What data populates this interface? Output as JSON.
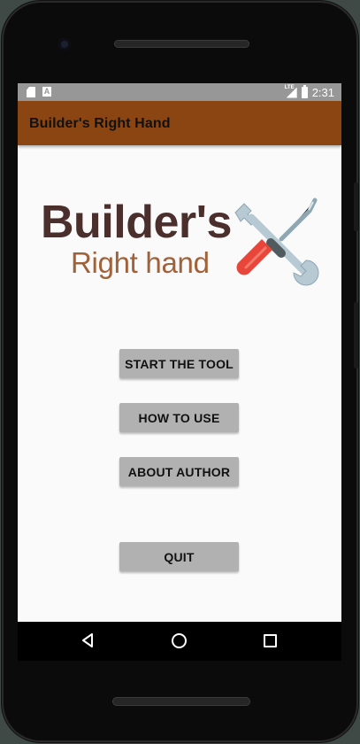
{
  "status_bar": {
    "time": "2:31",
    "signal_label": "LTE"
  },
  "app_bar": {
    "title": "Builder's Right Hand"
  },
  "logo": {
    "title": "Builder's",
    "subtitle": "Right hand",
    "title_color": "#4a2f2c",
    "subtitle_color": "#a0623a"
  },
  "buttons": {
    "start": "START THE TOOL",
    "how_to_use": "HOW TO USE",
    "about": "ABOUT AUTHOR",
    "quit": "QUIT"
  },
  "colors": {
    "app_bar": "#8b4513",
    "button": "#b1b1b1",
    "screen_bg": "#fafafa"
  },
  "icons": [
    "sd-card-icon",
    "notification-a-icon",
    "signal-icon",
    "battery-icon",
    "tools-icon",
    "back-icon",
    "home-icon",
    "recents-icon"
  ]
}
